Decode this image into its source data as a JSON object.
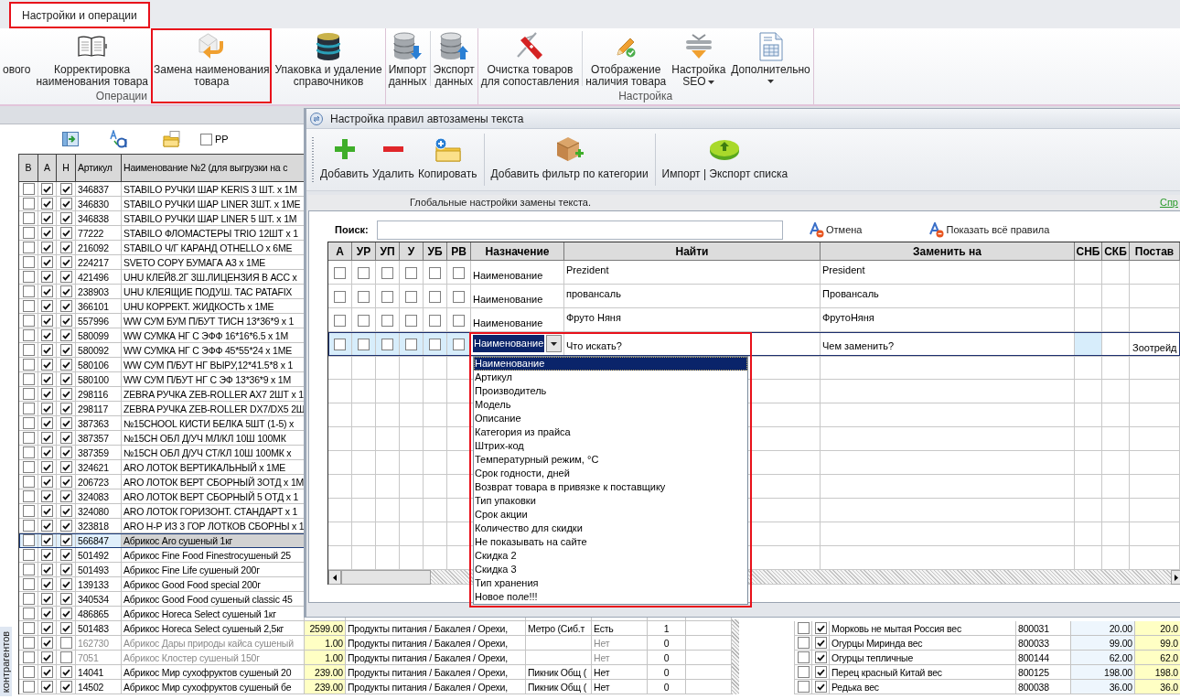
{
  "ribbon": {
    "tabs": [
      {
        "label": "Настройки и операции",
        "selected": true,
        "highlighted": true
      }
    ],
    "groups": [
      {
        "label": "Операции",
        "sections": [
          [
            {
              "lines": [
                "ового"
              ],
              "highlighted": false,
              "menu": false
            },
            {
              "lines": [
                "Корректировка",
                "наименования товара"
              ],
              "highlighted": false,
              "menu": false
            },
            {
              "lines": [
                "Замена наименования",
                "товара"
              ],
              "highlighted": true,
              "menu": false
            },
            {
              "lines": [
                "Упаковка и удаление",
                "справочников"
              ],
              "highlighted": false,
              "menu": false
            }
          ]
        ]
      },
      {
        "sections": [
          [
            {
              "lines": [
                "Импорт",
                "данных"
              ],
              "highlighted": false,
              "menu": false
            }
          ],
          [
            {
              "lines": [
                "Экспорт",
                "данных"
              ],
              "highlighted": false,
              "menu": false
            }
          ]
        ]
      },
      {
        "label": "Настройка",
        "sections": [
          [
            {
              "lines": [
                "Очистка товаров",
                "для сопоставления"
              ],
              "highlighted": false,
              "menu": false
            }
          ],
          [
            {
              "lines": [
                "Отображение",
                "наличия товара"
              ],
              "highlighted": false,
              "menu": false
            },
            {
              "lines": [
                "Настройка",
                "SEO"
              ],
              "highlighted": false,
              "menu": true
            },
            {
              "lines": [
                "Дополнительно"
              ],
              "highlighted": false,
              "menu": true
            }
          ]
        ]
      }
    ]
  },
  "side_tab": {
    "label": "контрагентов"
  },
  "toolbar": {
    "checkbox": {
      "label": "РР",
      "checked": false
    }
  },
  "table": {
    "columns": [
      "В",
      "А",
      "Н",
      "Артикул",
      "Наименование №2 (для выгрузки на с"
    ],
    "rows": [
      {
        "checks": [
          false,
          true,
          true
        ],
        "article": "346837",
        "name": "STABILO РУЧКИ ШАР KERIS 3 ШТ. x 1М",
        "selected": false,
        "dimmed": false
      },
      {
        "checks": [
          false,
          true,
          true
        ],
        "article": "346830",
        "name": "STABILO РУЧКИ ШАР LINER 3ШТ. x 1МЕ",
        "selected": false,
        "dimmed": false
      },
      {
        "checks": [
          false,
          true,
          true
        ],
        "article": "346838",
        "name": "STABILO РУЧКИ ШАР LINER 5 ШТ. x 1М",
        "selected": false,
        "dimmed": false
      },
      {
        "checks": [
          false,
          true,
          true
        ],
        "article": "77222",
        "name": "STABILO ФЛОМАСТЕРЫ TRIO 12ШТ x 1",
        "selected": false,
        "dimmed": false
      },
      {
        "checks": [
          false,
          true,
          true
        ],
        "article": "216092",
        "name": "STABILO Ч/Г КАРАНД OTHELLO x 6МЕ",
        "selected": false,
        "dimmed": false
      },
      {
        "checks": [
          false,
          true,
          true
        ],
        "article": "224217",
        "name": "SVETO COPY БУМАГА А3 x 1МЕ",
        "selected": false,
        "dimmed": false
      },
      {
        "checks": [
          false,
          true,
          true
        ],
        "article": "421496",
        "name": "UHU КЛЕЙ8.2Г 3Ш.ЛИЦЕНЗИЯ В АСС x",
        "selected": false,
        "dimmed": false
      },
      {
        "checks": [
          false,
          true,
          true
        ],
        "article": "238903",
        "name": "UHU КЛЕЯЩИЕ ПОДУШ. ТАС PATAFIX",
        "selected": false,
        "dimmed": false
      },
      {
        "checks": [
          false,
          true,
          true
        ],
        "article": "366101",
        "name": "UHU КОРРЕКТ. ЖИДКОСТЬ x 1МЕ",
        "selected": false,
        "dimmed": false
      },
      {
        "checks": [
          false,
          true,
          true
        ],
        "article": "557996",
        "name": "WW СУМ БУМ П/БУТ ТИСН 13*36*9 x 1",
        "selected": false,
        "dimmed": false
      },
      {
        "checks": [
          false,
          true,
          true
        ],
        "article": "580099",
        "name": "WW СУМКА НГ С ЭФФ 16*16*6.5 x 1М",
        "selected": false,
        "dimmed": false
      },
      {
        "checks": [
          false,
          true,
          true
        ],
        "article": "580092",
        "name": "WW СУМКА НГ С ЭФФ 45*55*24 x 1МЕ",
        "selected": false,
        "dimmed": false
      },
      {
        "checks": [
          false,
          true,
          true
        ],
        "article": "580106",
        "name": "WW СУМ П/БУТ НГ ВЫРУ,12*41.5*8 x 1",
        "selected": false,
        "dimmed": false
      },
      {
        "checks": [
          false,
          true,
          true
        ],
        "article": "580100",
        "name": "WW СУМ П/БУТ НГ С ЭФ 13*36*9 x 1М",
        "selected": false,
        "dimmed": false
      },
      {
        "checks": [
          false,
          true,
          true
        ],
        "article": "298116",
        "name": "ZEBRA РУЧКА ZEB-ROLLER AX7 2ШТ x 1",
        "selected": false,
        "dimmed": false
      },
      {
        "checks": [
          false,
          true,
          true
        ],
        "article": "298117",
        "name": "ZEBRA РУЧКА ZEB-ROLLER DX7/DX5 2Ш",
        "selected": false,
        "dimmed": false
      },
      {
        "checks": [
          false,
          true,
          true
        ],
        "article": "387363",
        "name": "№15CHOOL КИСТИ БЕЛКА 5ШТ (1-5) x",
        "selected": false,
        "dimmed": false
      },
      {
        "checks": [
          false,
          true,
          true
        ],
        "article": "387357",
        "name": "№15CH ОБЛ Д/УЧ МЛ/КЛ 10Ш 100МК",
        "selected": false,
        "dimmed": false
      },
      {
        "checks": [
          false,
          true,
          true
        ],
        "article": "387359",
        "name": "№15CH ОБЛ Д/УЧ СТ/КЛ 10Ш 100МК x",
        "selected": false,
        "dimmed": false
      },
      {
        "checks": [
          false,
          true,
          true
        ],
        "article": "324621",
        "name": "ARO ЛОТОК ВЕРТИКАЛЬНЫЙ x 1МЕ",
        "selected": false,
        "dimmed": false
      },
      {
        "checks": [
          false,
          true,
          true
        ],
        "article": "206723",
        "name": "ARO ЛОТОК ВЕРТ СБОРНЫЙ 3ОТД x 1М",
        "selected": false,
        "dimmed": false
      },
      {
        "checks": [
          false,
          true,
          true
        ],
        "article": "324083",
        "name": "ARO ЛОТОК ВЕРТ СБОРНЫЙ 5 ОТД x 1",
        "selected": false,
        "dimmed": false
      },
      {
        "checks": [
          false,
          true,
          true
        ],
        "article": "324080",
        "name": "ARO ЛОТОК ГОРИЗОНТ. СТАНДАРТ x 1",
        "selected": false,
        "dimmed": false
      },
      {
        "checks": [
          false,
          true,
          true
        ],
        "article": "323818",
        "name": "ARO Н-Р ИЗ 3 ГОР ЛОТКОВ СБОРНЫ x 1",
        "selected": false,
        "dimmed": false
      },
      {
        "checks": [
          false,
          true,
          true
        ],
        "article": "566847",
        "name": "Абрикос Aro сушеный 1кг",
        "selected": true,
        "dimmed": false
      },
      {
        "checks": [
          false,
          true,
          true
        ],
        "article": "501492",
        "name": "Абрикос Fine Food Finestrocушеный 25",
        "selected": false,
        "dimmed": false
      },
      {
        "checks": [
          false,
          true,
          true
        ],
        "article": "501493",
        "name": "Абрикос Fine Life сушеный 200г",
        "selected": false,
        "dimmed": false
      },
      {
        "checks": [
          false,
          true,
          true
        ],
        "article": "139133",
        "name": "Абрикос Good Food special 200г",
        "selected": false,
        "dimmed": false
      },
      {
        "checks": [
          false,
          true,
          true
        ],
        "article": "340534",
        "name": "Абрикос Good Food сушеный classic 45",
        "selected": false,
        "dimmed": false
      },
      {
        "checks": [
          false,
          true,
          true
        ],
        "article": "486865",
        "name": "Абрикос Horeca Select сушеный 1кг",
        "selected": false,
        "dimmed": false
      },
      {
        "checks": [
          false,
          true,
          true
        ],
        "article": "501483",
        "name": "Абрикос Horeca Select сушеный 2,5кг",
        "selected": false,
        "dimmed": false,
        "price": "2599.00",
        "category": "Продукты питания / Бакалея / Орехи,",
        "supplier": "Метро (Сиб.т",
        "availability": "Есть",
        "count": "1"
      },
      {
        "checks": [
          false,
          true,
          false
        ],
        "article": "162730",
        "name": "Абрикос Дары природы кайса сушеный",
        "selected": false,
        "dimmed": true,
        "price": "1.00",
        "category": "Продукты питания / Бакалея / Орехи,",
        "availability": "Нет",
        "count": "0"
      },
      {
        "checks": [
          false,
          true,
          false
        ],
        "article": "7051",
        "name": "Абрикос Клостер сушеный 150г",
        "selected": false,
        "dimmed": true,
        "price": "1.00",
        "category": "Продукты питания / Бакалея / Орехи,",
        "availability": "Нет",
        "count": "0"
      },
      {
        "checks": [
          false,
          true,
          true
        ],
        "article": "14041",
        "name": "Абрикос Мир сухофруктов сушеный 20",
        "selected": false,
        "dimmed": false,
        "price": "239.00",
        "category": "Продукты питания / Бакалея / Орехи,",
        "supplier": "Пикник Общ (",
        "availability": "Нет",
        "count": "0"
      },
      {
        "checks": [
          false,
          true,
          true
        ],
        "article": "14502",
        "name": "Абрикос Мир сухофруктов сушеный бе",
        "selected": false,
        "dimmed": false,
        "price": "239.00",
        "category": "Продукты питания / Бакалея / Орехи,",
        "supplier": "Пикник Общ (",
        "availability": "Нет",
        "count": "0"
      }
    ]
  },
  "side_table": {
    "rows": [
      {
        "checks": [
          false,
          true
        ],
        "name": "Морковь не мытая Россия вес",
        "code": "800031",
        "price": "20.00",
        "price_2": "20.0"
      },
      {
        "checks": [
          false,
          true
        ],
        "name": "Огурцы Миринда вес",
        "code": "800033",
        "price": "99.00",
        "price_2": "99.0"
      },
      {
        "checks": [
          false,
          true
        ],
        "name": "Огурцы тепличные",
        "code": "800144",
        "price": "62.00",
        "price_2": "62.0"
      },
      {
        "checks": [
          false,
          true
        ],
        "name": "Перец красный Китай вес",
        "code": "800125",
        "price": "198.00",
        "price_2": "198.0"
      },
      {
        "checks": [
          false,
          true
        ],
        "name": "Редька вес",
        "code": "800038",
        "price": "36.00",
        "price_2": "36.0"
      }
    ]
  },
  "dialog": {
    "title": "Настройка правил автозамены текста",
    "toolbar": [
      [
        {
          "label": "Добавить"
        },
        {
          "label": "Удалить"
        },
        {
          "label": "Копировать"
        }
      ],
      [
        {
          "label": "Добавить фильтр по категории"
        }
      ],
      [
        {
          "label": "Импорт | Экспорт списка"
        }
      ]
    ],
    "panel_title": "Глобальные настройки замены текста.",
    "help_link": "Спр",
    "search": {
      "label": "Поиск:"
    },
    "actions": [
      {
        "label": "Отмена"
      },
      {
        "label": "Показать всё правила"
      }
    ],
    "grid": {
      "columns": [
        "А",
        "УР",
        "УП",
        "У",
        "УБ",
        "РВ",
        "Назначение",
        "Найти",
        "Заменить на",
        "СНБ",
        "СКБ",
        "Постав"
      ],
      "rows": [
        {
          "kind": "rule",
          "selected": false,
          "flags": [
            false,
            false,
            false,
            false,
            false,
            false
          ],
          "target": "Наименование",
          "find": "Prezident",
          "replace": "President"
        },
        {
          "kind": "rule",
          "selected": false,
          "flags": [
            false,
            false,
            false,
            false,
            false,
            false
          ],
          "target": "Наименование",
          "find": "провансаль",
          "replace": "Провансаль"
        },
        {
          "kind": "rule",
          "selected": false,
          "flags": [
            false,
            false,
            false,
            false,
            false,
            false
          ],
          "target": "Наименование",
          "find": "Фруто Няня",
          "replace": "ФрутоНяня"
        },
        {
          "kind": "new",
          "selected": true,
          "flags": [
            false,
            false,
            false,
            false,
            false,
            false
          ],
          "target": "Наименование",
          "find_placeholder": "Что искать?",
          "replace_placeholder": "Чем заменить?",
          "supplier": "Зоотрейд"
        }
      ]
    },
    "dropdown": {
      "highlighted": true,
      "options": [
        {
          "label": "Наименование",
          "selected": true
        },
        {
          "label": "Артикул",
          "selected": false
        },
        {
          "label": "Производитель",
          "selected": false
        },
        {
          "label": "Модель",
          "selected": false
        },
        {
          "label": "Описание",
          "selected": false
        },
        {
          "label": "Категория из прайса",
          "selected": false
        },
        {
          "label": "Штрих-код",
          "selected": false
        },
        {
          "label": "Температурный режим, °С",
          "selected": false
        },
        {
          "label": "Срок годности, дней",
          "selected": false
        },
        {
          "label": "Возврат товара в привязке к поставщику",
          "selected": false
        },
        {
          "label": "Тип упаковки",
          "selected": false
        },
        {
          "label": "Срок акции",
          "selected": false
        },
        {
          "label": "Количество для скидки",
          "selected": false
        },
        {
          "label": "Не показывать на сайте",
          "selected": false
        },
        {
          "label": "Скидка 2",
          "selected": false
        },
        {
          "label": "Скидка 3",
          "selected": false
        },
        {
          "label": "Тип хранения",
          "selected": false
        },
        {
          "label": "Новое поле!!!",
          "selected": false
        }
      ]
    }
  }
}
